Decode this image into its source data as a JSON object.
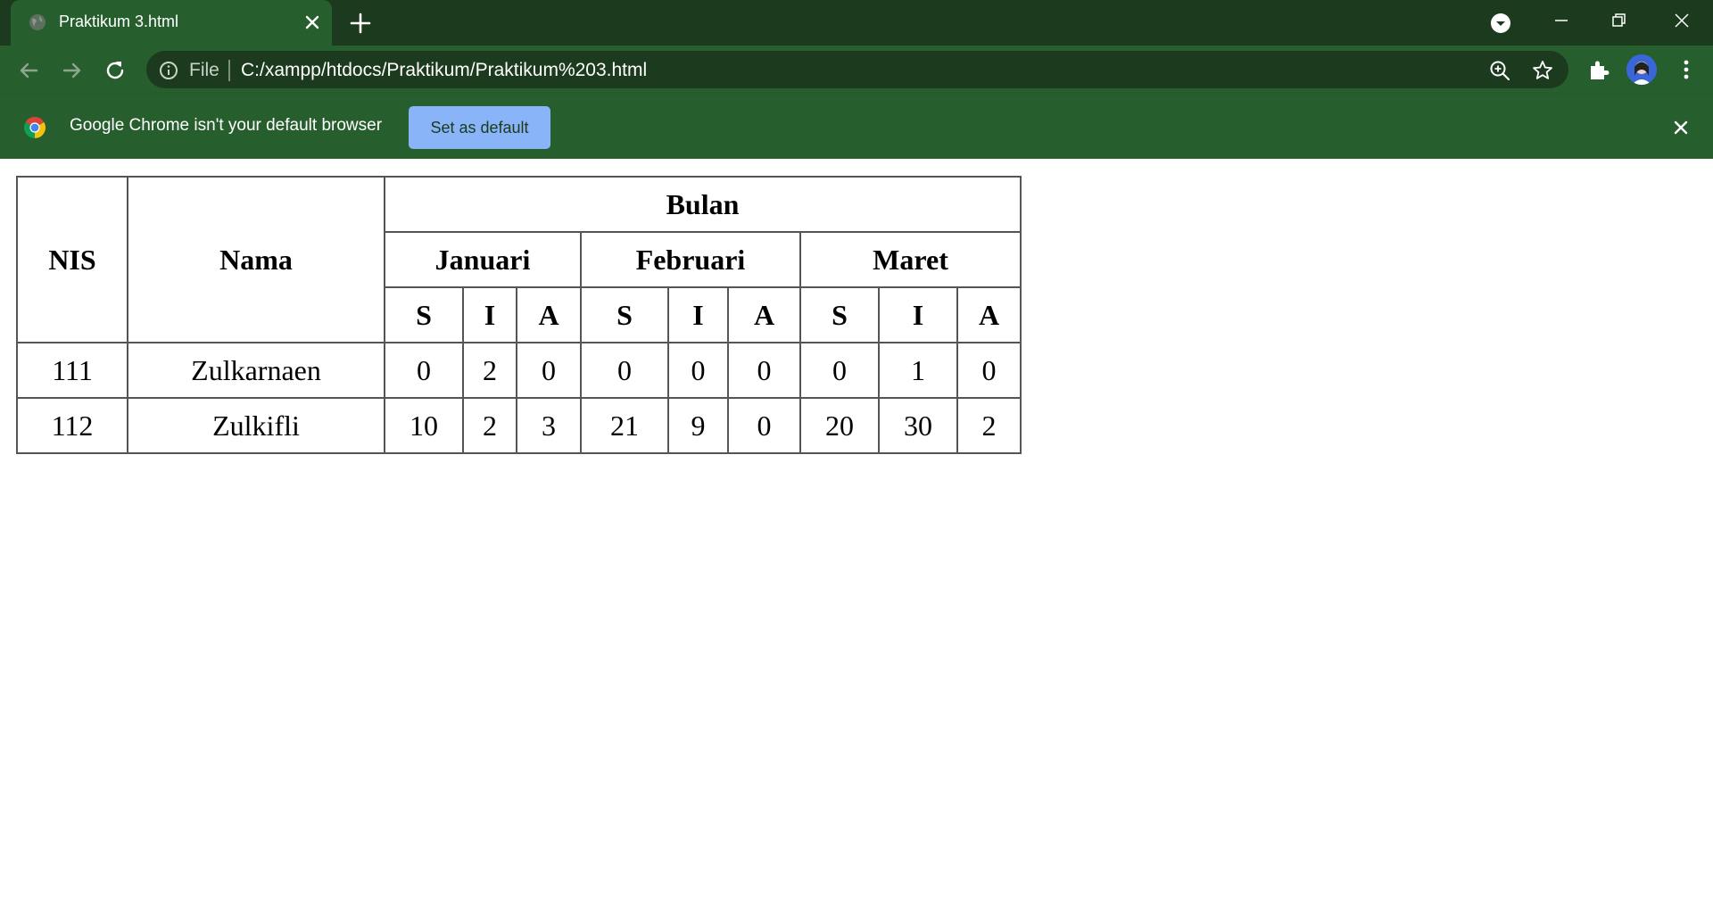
{
  "browser": {
    "tab_title": "Praktikum 3.html",
    "address": {
      "scheme_label": "File",
      "url": "C:/xampp/htdocs/Praktikum/Praktikum%203.html"
    },
    "infobar": {
      "message": "Google Chrome isn't your default browser",
      "button_label": "Set as default"
    }
  },
  "table": {
    "header": {
      "nis": "NIS",
      "nama": "Nama",
      "bulan": "Bulan",
      "months": [
        "Januari",
        "Februari",
        "Maret"
      ],
      "sub": [
        "S",
        "I",
        "A",
        "S",
        "I",
        "A",
        "S",
        "I",
        "A"
      ]
    },
    "rows": [
      {
        "nis": "111",
        "nama": "Zulkarnaen",
        "values": [
          "0",
          "2",
          "0",
          "0",
          "0",
          "0",
          "0",
          "1",
          "0"
        ]
      },
      {
        "nis": "112",
        "nama": "Zulkifli",
        "values": [
          "10",
          "2",
          "3",
          "21",
          "9",
          "0",
          "20",
          "30",
          "2"
        ]
      }
    ]
  }
}
